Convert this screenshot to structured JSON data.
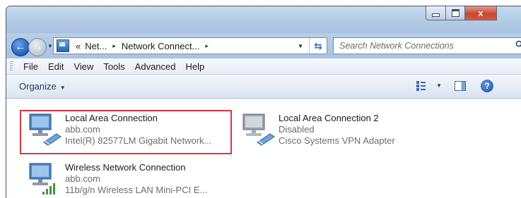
{
  "window": {
    "controls": {
      "minimize": "minimize",
      "maximize": "maximize",
      "close": "x"
    }
  },
  "address_bar": {
    "overflow": "«",
    "breadcrumbs": [
      "Net...",
      "Network Connect..."
    ],
    "separator": "▸",
    "search_placeholder": "Search Network Connections"
  },
  "menu": {
    "items": [
      "File",
      "Edit",
      "View",
      "Tools",
      "Advanced",
      "Help"
    ]
  },
  "command_bar": {
    "organize_label": "Organize"
  },
  "connections": [
    {
      "name": "Local Area Connection",
      "status": "abb.com",
      "device": "Intel(R) 82577LM Gigabit Network...",
      "icon": "ethernet-adapter-icon",
      "selected": true
    },
    {
      "name": "Local Area Connection 2",
      "status": "Disabled",
      "device": "Cisco Systems VPN Adapter",
      "icon": "ethernet-adapter-icon",
      "selected": false
    },
    {
      "name": "Wireless Network Connection",
      "status": "abb.com",
      "device": "11b/g/n  Wireless LAN Mini-PCI E...",
      "icon": "wireless-adapter-icon",
      "selected": false
    }
  ],
  "colors": {
    "selection_outline": "#d3363e",
    "titlebar": "#b6cde6",
    "close_button": "#c84732"
  }
}
